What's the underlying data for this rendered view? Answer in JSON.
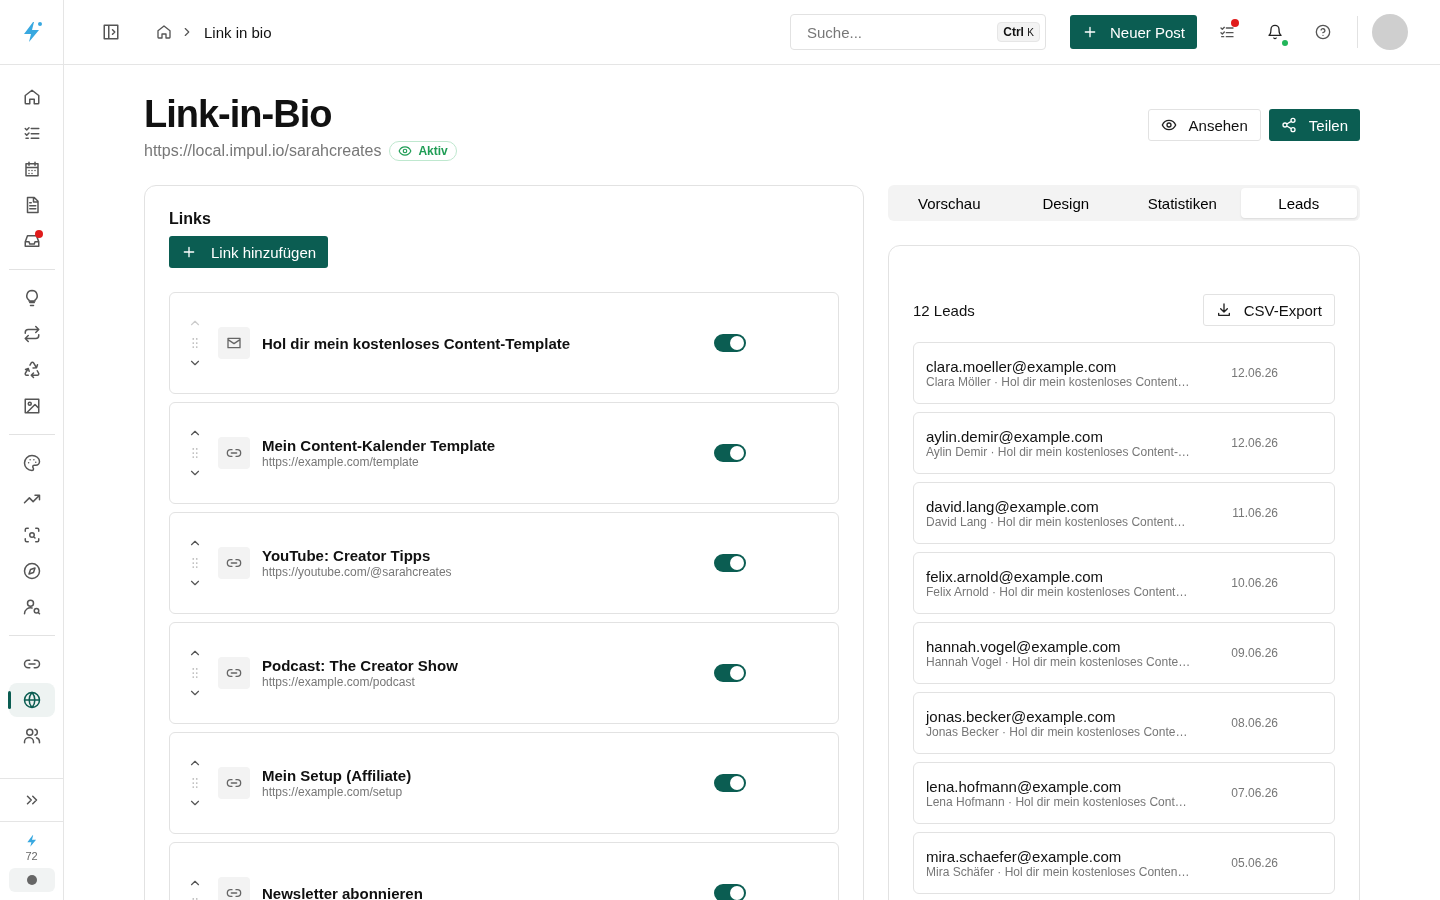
{
  "sidebar": {
    "groups": [
      {
        "items": [
          {
            "selected": false,
            "notification": false
          },
          {
            "selected": false,
            "notification": false
          },
          {
            "selected": false,
            "notification": false
          },
          {
            "selected": false,
            "notification": false
          },
          {
            "selected": false,
            "notification": true
          }
        ]
      },
      {
        "items": [
          {
            "selected": false,
            "notification": false
          },
          {
            "selected": false,
            "notification": false
          },
          {
            "selected": false,
            "notification": false
          },
          {
            "selected": false,
            "notification": false
          }
        ]
      },
      {
        "items": [
          {
            "selected": false,
            "notification": false
          },
          {
            "selected": false,
            "notification": false
          },
          {
            "selected": false,
            "notification": false
          },
          {
            "selected": false,
            "notification": false
          },
          {
            "selected": false,
            "notification": false
          }
        ]
      },
      {
        "items": [
          {
            "selected": false,
            "notification": false
          },
          {
            "selected": true,
            "notification": false
          },
          {
            "selected": false,
            "notification": false
          }
        ]
      }
    ],
    "credits": "72"
  },
  "header": {
    "breadcrumb": "Link in bio",
    "search": {
      "placeholder": "Suche...",
      "shortcut": [
        "Ctrl",
        "K"
      ]
    },
    "new_post": "Neuer Post",
    "tasks_notification": true,
    "bell_online": true
  },
  "page": {
    "title": "Link-in-Bio",
    "url": "https://local.impul.io/sarahcreates",
    "status": "Aktiv",
    "view_button": "Ansehen",
    "share_button": "Teilen"
  },
  "links_panel": {
    "title": "Links",
    "add_button": "Link hinzufügen",
    "links": [
      {
        "kind": "mail",
        "title": "Hol dir mein kostenloses Content-Template",
        "on": true,
        "up_disabled": true
      },
      {
        "kind": "link",
        "title": "Mein Content-Kalender Template",
        "url": "https://example.com/template",
        "on": true,
        "up_disabled": false
      },
      {
        "kind": "link",
        "title": "YouTube: Creator Tipps",
        "url": "https://youtube.com/@sarahcreates",
        "on": true,
        "up_disabled": false
      },
      {
        "kind": "link",
        "title": "Podcast: The Creator Show",
        "url": "https://example.com/podcast",
        "on": true,
        "up_disabled": false
      },
      {
        "kind": "link",
        "title": "Mein Setup (Affiliate)",
        "url": "https://example.com/setup",
        "on": true,
        "up_disabled": false
      },
      {
        "kind": "link",
        "title": "Newsletter abonnieren",
        "on": true,
        "up_disabled": false
      }
    ]
  },
  "tabs": [
    {
      "label": "Vorschau",
      "selected": false
    },
    {
      "label": "Design",
      "selected": false
    },
    {
      "label": "Statistiken",
      "selected": false
    },
    {
      "label": "Leads",
      "selected": true
    }
  ],
  "leads_panel": {
    "count": "12 Leads",
    "export_button": "CSV-Export",
    "leads": [
      {
        "email": "clara.moeller@example.com",
        "detail": "Clara Möller · Hol dir mein kostenloses Content…",
        "date": "12.06.26"
      },
      {
        "email": "aylin.demir@example.com",
        "detail": "Aylin Demir · Hol dir mein kostenloses Content-…",
        "date": "12.06.26"
      },
      {
        "email": "david.lang@example.com",
        "detail": "David Lang · Hol dir mein kostenloses Content…",
        "date": "11.06.26"
      },
      {
        "email": "felix.arnold@example.com",
        "detail": "Felix Arnold · Hol dir mein kostenloses Content…",
        "date": "10.06.26"
      },
      {
        "email": "hannah.vogel@example.com",
        "detail": "Hannah Vogel · Hol dir mein kostenloses Conte…",
        "date": "09.06.26"
      },
      {
        "email": "jonas.becker@example.com",
        "detail": "Jonas Becker · Hol dir mein kostenloses Conte…",
        "date": "08.06.26"
      },
      {
        "email": "lena.hofmann@example.com",
        "detail": "Lena Hofmann · Hol dir mein kostenloses Cont…",
        "date": "07.06.26"
      },
      {
        "email": "mira.schaefer@example.com",
        "detail": "Mira Schäfer · Hol dir mein kostenloses Conten…",
        "date": "05.06.26"
      }
    ]
  }
}
